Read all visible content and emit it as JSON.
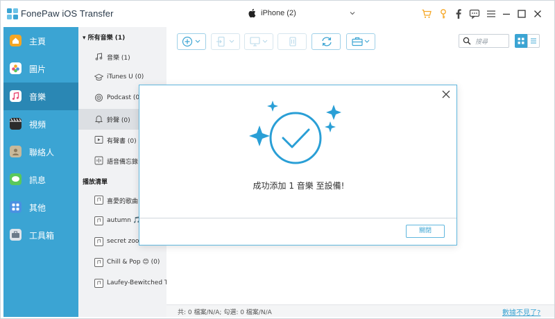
{
  "app": {
    "title": "FonePaw iOS Transfer"
  },
  "device": {
    "label": "iPhone (2)"
  },
  "titlebar_icons": [
    "cart-icon",
    "key-icon",
    "facebook-icon",
    "chat-icon",
    "menu-icon",
    "minimize-icon",
    "maximize-icon",
    "close-icon"
  ],
  "nav": {
    "items": [
      {
        "label": "主頁",
        "icon": "home-icon",
        "color": "#f5a623"
      },
      {
        "label": "圖片",
        "icon": "photos-icon",
        "color": "#e94e77"
      },
      {
        "label": "音樂",
        "icon": "music-icon",
        "color": "#f5f5f5"
      },
      {
        "label": "視頻",
        "icon": "video-icon",
        "color": "#333333"
      },
      {
        "label": "聯絡人",
        "icon": "contacts-icon",
        "color": "#c9b99a"
      },
      {
        "label": "訊息",
        "icon": "messages-icon",
        "color": "#5ac85a"
      },
      {
        "label": "其他",
        "icon": "other-icon",
        "color": "#4a90e2"
      },
      {
        "label": "工具箱",
        "icon": "toolbox-icon",
        "color": "#9aa7b5"
      }
    ],
    "active_index": 2
  },
  "categories": {
    "all_music_header": "▾ 所有音樂 (1)",
    "items": [
      {
        "label": "音樂 (1)",
        "icon": "music-note-icon"
      },
      {
        "label": "iTunes U (0)",
        "icon": "graduation-icon"
      },
      {
        "label": "Podcast (0)",
        "icon": "podcast-icon"
      },
      {
        "label": "鈴聲 (0)",
        "icon": "bell-icon"
      },
      {
        "label": "有聲書 (0)",
        "icon": "audiobook-icon"
      },
      {
        "label": "語音備忘錄 (",
        "icon": "voice-memo-icon"
      }
    ],
    "active_index": 3,
    "playlist_header": "播放清單",
    "playlists": [
      {
        "label": "喜愛的歌曲 ("
      },
      {
        "label": "autumn 🎵 ("
      },
      {
        "label": "secret zoom..."
      },
      {
        "label": "Chill & Pop 😊 (0)"
      },
      {
        "label": "Laufey-Bewitched T..."
      }
    ]
  },
  "toolbar": {
    "buttons": [
      {
        "name": "add-button",
        "icon": "plus-circle-icon",
        "dropdown": true
      },
      {
        "name": "export-device-button",
        "icon": "phone-export-icon",
        "dropdown": true
      },
      {
        "name": "export-pc-button",
        "icon": "monitor-export-icon",
        "dropdown": true
      },
      {
        "name": "delete-button",
        "icon": "trash-icon",
        "dropdown": false
      },
      {
        "name": "refresh-button",
        "icon": "refresh-icon",
        "dropdown": false
      },
      {
        "name": "toolbox-button",
        "icon": "briefcase-icon",
        "dropdown": true
      }
    ],
    "search_placeholder": "搜尋"
  },
  "status": {
    "summary": "共: 0 檔案/N/A; 勾選: 0 檔案/N/A",
    "link": "數據不見了?"
  },
  "modal": {
    "message": "成功添加 1 音樂 至設備!",
    "button": "關閉",
    "accent_color": "#2a9fd6"
  }
}
